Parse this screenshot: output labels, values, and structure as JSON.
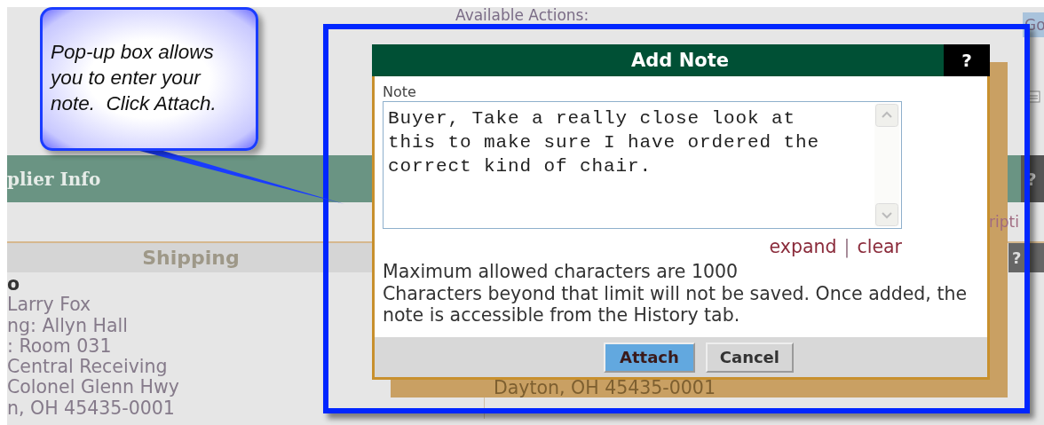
{
  "callout": {
    "text": "Pop-up box allows you to enter your note.  Click Attach."
  },
  "page": {
    "actions_heading": "Available Actions:",
    "go_button": "Go",
    "section_title": "plier Info",
    "section_help": "?",
    "link_fragment": "ripti",
    "shipping_header": "Shipping",
    "shipping_help": "?",
    "ship_to_lines": [
      "o",
      "Larry Fox",
      "ng: Allyn Hall",
      ": Room 031",
      "Central Receiving",
      "Colonel Glenn Hwy",
      "n, OH 45435-0001"
    ],
    "address_lines": [
      "Dayton, OH 45435-0001"
    ]
  },
  "dialog": {
    "title": "Add Note",
    "help": "?",
    "field_label": "Note",
    "value": "Buyer, Take a really close look at this to make sure I have ordered the correct kind of chair.",
    "links": [
      "expand",
      "clear"
    ],
    "link_separator": "|",
    "info_lines": [
      "Maximum allowed characters are 1000",
      "Characters beyond that limit will not be saved. Once added, the note is accessible from the History tab."
    ],
    "buttons": [
      {
        "label": "Attach",
        "selected": true
      },
      {
        "label": "Cancel",
        "selected": false
      }
    ]
  }
}
